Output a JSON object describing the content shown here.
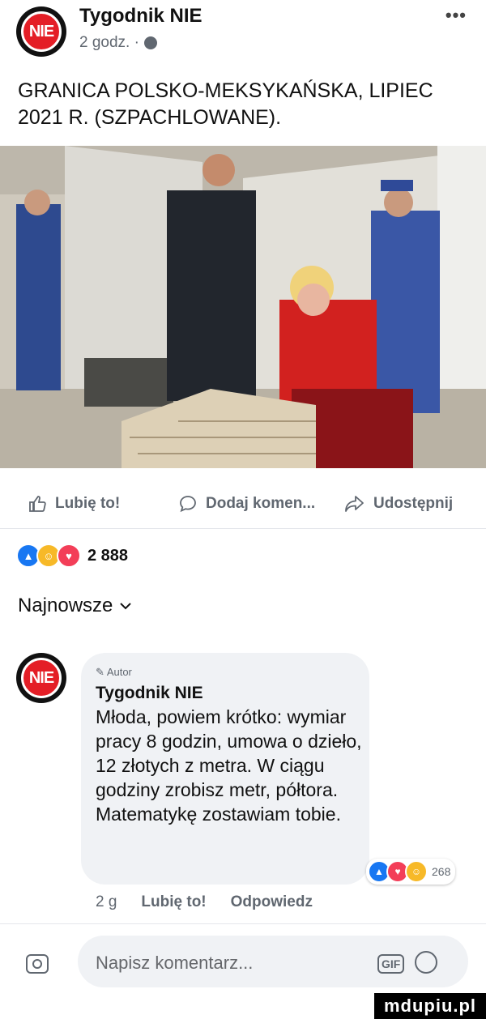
{
  "post": {
    "page_name": "Tygodnik NIE",
    "time": "2 godz. ·",
    "logo_text": "NIE",
    "more": "•••",
    "text": "GRANICA POLSKO-MEKSYKAŃSKA, LIPIEC 2021 R. (SZPACHLOWANE)."
  },
  "actions": {
    "like": "Lubię to!",
    "comment": "Dodaj komen...",
    "share": "Udostępnij"
  },
  "reactions": {
    "count": "2 888"
  },
  "sort": {
    "label": "Najnowsze"
  },
  "comment": {
    "logo_text": "NIE",
    "author_tag": "Autor",
    "author": "Tygodnik NIE",
    "text": "Młoda, powiem krótko: wymiar pracy 8 godzin, umowa o dzieło, 12 złotych z metra. W ciągu godziny zrobisz metr, półtora. Matematykę zostawiam tobie.",
    "reaction_count": "268",
    "time": "2 g",
    "like": "Lubię to!",
    "reply": "Odpowiedz"
  },
  "composer": {
    "placeholder": "Napisz komentarz...",
    "gif": "GIF"
  },
  "watermark": "mdupiu.pl",
  "colors": {
    "like": "#1877f2",
    "love": "#f33e58",
    "haha": "#f7b928",
    "logo_red": "#e41e26"
  }
}
